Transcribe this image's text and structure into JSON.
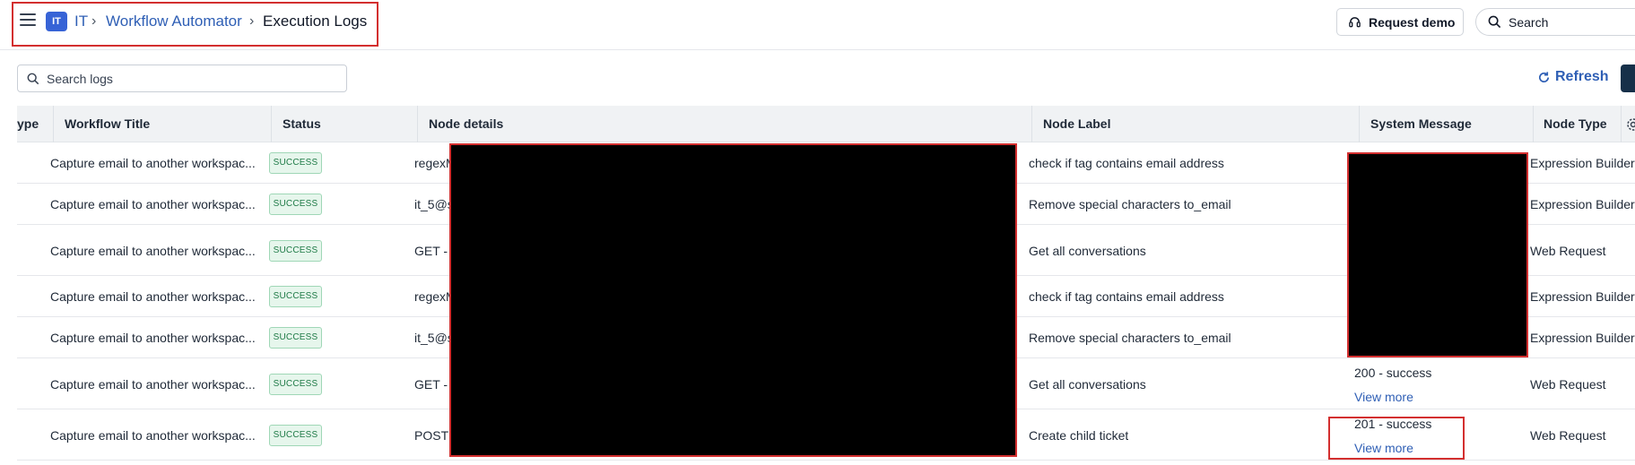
{
  "header": {
    "workspace_badge": "IT",
    "breadcrumb": [
      "IT",
      "Workflow Automator",
      "Execution Logs"
    ],
    "request_demo_label": "Request demo",
    "search_placeholder": "Search"
  },
  "toolbar": {
    "search_placeholder": "Search logs",
    "refresh_label": "Refresh"
  },
  "table": {
    "columns": [
      "ype",
      "Workflow Title",
      "Status",
      "Node details",
      "Node Label",
      "System Message",
      "Node Type"
    ],
    "rows": [
      {
        "workflow_title": "Capture email to another workspac...",
        "status": "SUCCESS",
        "node_details": "regexM",
        "node_label": "check if tag contains email address",
        "system_message": "",
        "view_more": "",
        "node_type": "Expression Builder"
      },
      {
        "workflow_title": "Capture email to another workspac...",
        "status": "SUCCESS",
        "node_details": "it_5@s",
        "node_label": "Remove special characters to_email",
        "system_message": "",
        "view_more": "",
        "node_type": "Expression Builder"
      },
      {
        "workflow_title": "Capture email to another workspac...",
        "status": "SUCCESS",
        "node_details": "GET - h",
        "node_label": "Get all conversations",
        "system_message": "",
        "view_more": "",
        "node_type": "Web Request"
      },
      {
        "workflow_title": "Capture email to another workspac...",
        "status": "SUCCESS",
        "node_details": "regexM",
        "node_label": "check if tag contains email address",
        "system_message": "",
        "view_more": "",
        "node_type": "Expression Builder"
      },
      {
        "workflow_title": "Capture email to another workspac...",
        "status": "SUCCESS",
        "node_details": "it_5@s",
        "node_label": "Remove special characters to_email",
        "system_message": "",
        "view_more": "",
        "node_type": "Expression Builder"
      },
      {
        "workflow_title": "Capture email to another workspac...",
        "status": "SUCCESS",
        "node_details": "GET - h",
        "node_label": "Get all conversations",
        "system_message": "200 - success",
        "view_more": "View more",
        "node_type": "Web Request"
      },
      {
        "workflow_title": "Capture email to another workspac...",
        "status": "SUCCESS",
        "node_details": "POST -",
        "node_label": "Create child ticket",
        "system_message": "201 - success",
        "view_more": "View more",
        "node_type": "Web Request"
      }
    ]
  }
}
